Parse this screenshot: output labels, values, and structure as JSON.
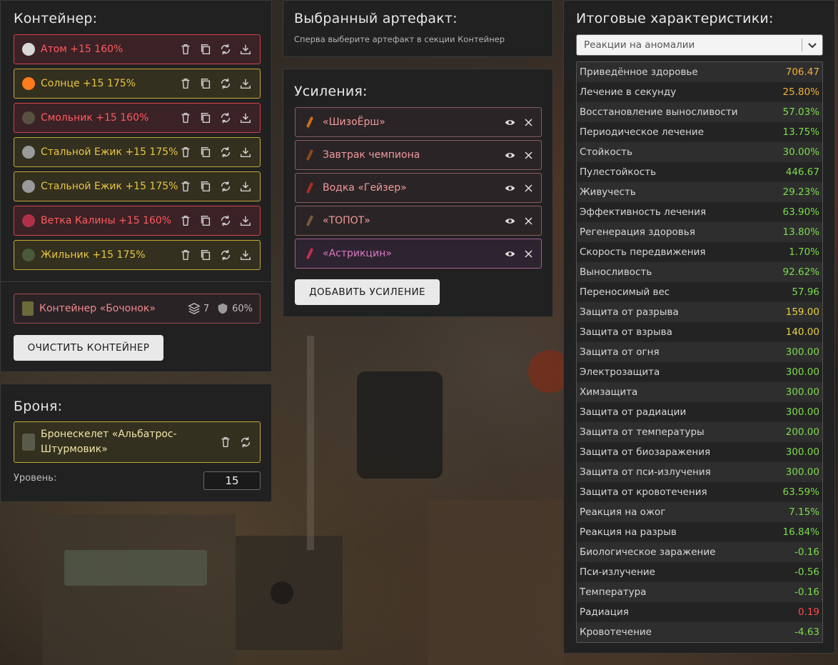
{
  "colors": {
    "red_border": "#d2434b",
    "yellow_border": "#c2a93a",
    "value_green": "#7ddc4c",
    "value_orange": "#f0b13a",
    "value_yellow": "#e6d23c",
    "value_red": "#ff4b4b"
  },
  "container": {
    "title": "Контейнер:",
    "artifacts": [
      {
        "label": "Атом +15 160%",
        "tier": "red",
        "icon": "atom-icon"
      },
      {
        "label": "Солнце +15 175%",
        "tier": "yellow",
        "icon": "sun-icon"
      },
      {
        "label": "Смольник +15 160%",
        "tier": "red",
        "icon": "resin-icon"
      },
      {
        "label": "Стальной Ежик +15 175%",
        "tier": "yellow",
        "icon": "hedgehog-icon"
      },
      {
        "label": "Стальной Ежик +15 175%",
        "tier": "yellow",
        "icon": "hedgehog-icon"
      },
      {
        "label": "Ветка Калины +15 160%",
        "tier": "red",
        "icon": "viburnum-icon"
      },
      {
        "label": "Жильник +15 175%",
        "tier": "yellow",
        "icon": "vein-icon"
      }
    ],
    "barrel": {
      "label": "Контейнер «Бочонок»",
      "slots": "7",
      "protection": "60%"
    },
    "clear_button": "ОЧИСТИТЬ КОНТЕЙНЕР"
  },
  "armor": {
    "title": "Броня:",
    "item_label": "Бронескелет «Альбатрос-Штурмовик»",
    "level_label": "Уровень:",
    "level_value": "15"
  },
  "selected": {
    "title": "Выбранный артефакт:",
    "hint": "Сперва выберите артефакт в секции Контейнер"
  },
  "boosts": {
    "title": "Усиления:",
    "items": [
      {
        "label": "«ШизоЁрш»",
        "style": "pink",
        "icon": "bottle-icon"
      },
      {
        "label": "Завтрак чемпиона",
        "style": "pink",
        "icon": "breakfast-icon"
      },
      {
        "label": "Водка «Гейзер»",
        "style": "pink",
        "icon": "vodka-icon"
      },
      {
        "label": "«ТОПОТ»",
        "style": "pink",
        "icon": "stick-icon"
      },
      {
        "label": "«Астрикцин»",
        "style": "purple",
        "icon": "syringe-icon"
      }
    ],
    "add_button": "ДОБАВИТЬ УСИЛЕНИЕ"
  },
  "totals": {
    "title": "Итоговые характеристики:",
    "select_value": "Реакции на аномалии",
    "stats": [
      {
        "name": "Приведённое здоровье",
        "value": "706.47",
        "color": "#f0b13a"
      },
      {
        "name": "Лечение в секунду",
        "value": "25.80%",
        "color": "#f0b13a"
      },
      {
        "name": "Восстановление выносливости",
        "value": "57.03%",
        "color": "#7ddc4c"
      },
      {
        "name": "Периодическое лечение",
        "value": "13.75%",
        "color": "#7ddc4c"
      },
      {
        "name": "Стойкость",
        "value": "30.00%",
        "color": "#7ddc4c"
      },
      {
        "name": "Пулестойкость",
        "value": "446.67",
        "color": "#7ddc4c"
      },
      {
        "name": "Живучесть",
        "value": "29.23%",
        "color": "#7ddc4c"
      },
      {
        "name": "Эффективность лечения",
        "value": "63.90%",
        "color": "#7ddc4c"
      },
      {
        "name": "Регенерация здоровья",
        "value": "13.80%",
        "color": "#7ddc4c"
      },
      {
        "name": "Скорость передвижения",
        "value": "1.70%",
        "color": "#7ddc4c"
      },
      {
        "name": "Выносливость",
        "value": "92.62%",
        "color": "#7ddc4c"
      },
      {
        "name": "Переносимый вес",
        "value": "57.96",
        "color": "#7ddc4c"
      },
      {
        "name": "Защита от разрыва",
        "value": "159.00",
        "color": "#e6d23c"
      },
      {
        "name": "Защита от взрыва",
        "value": "140.00",
        "color": "#e6d23c"
      },
      {
        "name": "Защита от огня",
        "value": "300.00",
        "color": "#7ddc4c"
      },
      {
        "name": "Электрозащита",
        "value": "300.00",
        "color": "#7ddc4c"
      },
      {
        "name": "Химзащита",
        "value": "300.00",
        "color": "#7ddc4c"
      },
      {
        "name": "Защита от радиации",
        "value": "300.00",
        "color": "#7ddc4c"
      },
      {
        "name": "Защита от температуры",
        "value": "200.00",
        "color": "#7ddc4c"
      },
      {
        "name": "Защита от биозаражения",
        "value": "300.00",
        "color": "#7ddc4c"
      },
      {
        "name": "Защита от пси-излучения",
        "value": "300.00",
        "color": "#7ddc4c"
      },
      {
        "name": "Защита от кровотечения",
        "value": "63.59%",
        "color": "#7ddc4c"
      },
      {
        "name": "Реакция на ожог",
        "value": "7.15%",
        "color": "#7ddc4c"
      },
      {
        "name": "Реакция на разрыв",
        "value": "16.84%",
        "color": "#7ddc4c"
      },
      {
        "name": "Биологическое заражение",
        "value": "-0.16",
        "color": "#7ddc4c"
      },
      {
        "name": "Пси-излучение",
        "value": "-0.56",
        "color": "#7ddc4c"
      },
      {
        "name": "Температура",
        "value": "-0.16",
        "color": "#7ddc4c"
      },
      {
        "name": "Радиация",
        "value": "0.19",
        "color": "#ff4b4b"
      },
      {
        "name": "Кровотечение",
        "value": "-4.63",
        "color": "#7ddc4c"
      }
    ]
  }
}
